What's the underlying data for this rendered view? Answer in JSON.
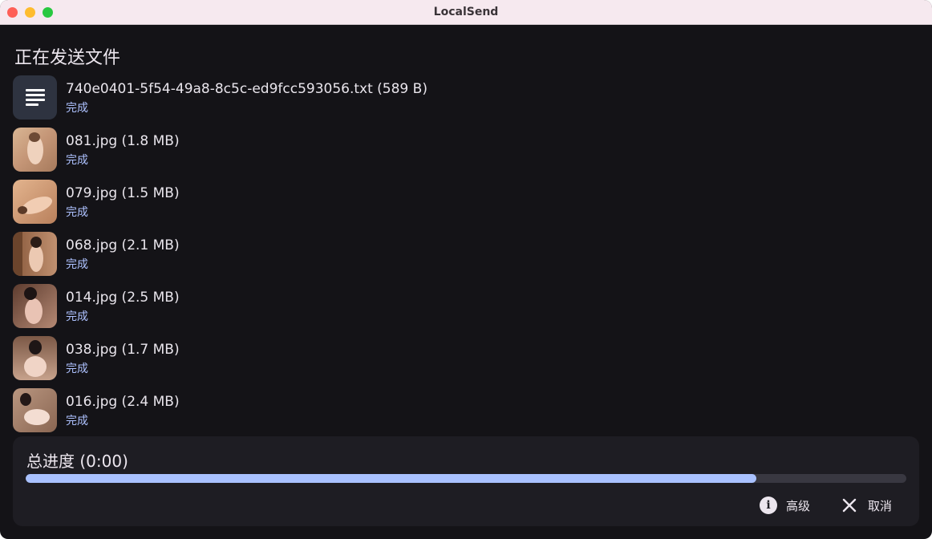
{
  "window": {
    "title": "LocalSend"
  },
  "heading": "正在发送文件",
  "files": [
    {
      "name": "740e0401-5f54-49a8-8c5c-ed9fcc593056.txt (589 B)",
      "status": "完成",
      "thumb": "document-icon"
    },
    {
      "name": "081.jpg (1.8 MB)",
      "status": "完成",
      "thumb": "photo-thumbnail"
    },
    {
      "name": "079.jpg (1.5 MB)",
      "status": "完成",
      "thumb": "photo-thumbnail"
    },
    {
      "name": "068.jpg (2.1 MB)",
      "status": "完成",
      "thumb": "photo-thumbnail"
    },
    {
      "name": "014.jpg (2.5 MB)",
      "status": "完成",
      "thumb": "photo-thumbnail"
    },
    {
      "name": "038.jpg (1.7 MB)",
      "status": "完成",
      "thumb": "photo-thumbnail"
    },
    {
      "name": "016.jpg (2.4 MB)",
      "status": "完成",
      "thumb": "photo-thumbnail"
    }
  ],
  "progress": {
    "title": "总进度 (0:00)",
    "fraction": 0.83
  },
  "actions": {
    "advanced_label": "高级",
    "advanced_icon": "info-icon",
    "cancel_label": "取消",
    "cancel_icon": "close-icon"
  },
  "colors": {
    "accent": "#a9c1ff",
    "status": "#aec2ff",
    "background": "#141317",
    "panel": "#1e1d23"
  }
}
